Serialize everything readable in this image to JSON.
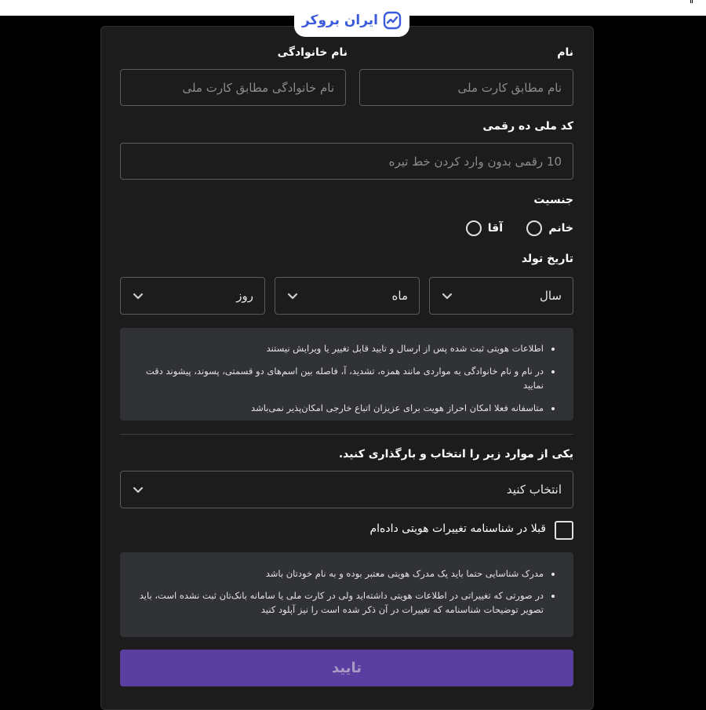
{
  "brand": {
    "name": "ایران بروکر",
    "accent": "#3b5bdb"
  },
  "form": {
    "first_name": {
      "label": "نام",
      "placeholder": "نام مطابق کارت ملی"
    },
    "last_name": {
      "label": "نام خانوادگی",
      "placeholder": "نام خانوادگی مطابق کارت ملی"
    },
    "national_code": {
      "label": "کد ملی ده رقمی",
      "placeholder": "10 رقمی بدون وارد کردن خط تیره"
    },
    "gender": {
      "label": "جنسیت",
      "options": [
        "خانم",
        "آقا"
      ]
    },
    "birth_date": {
      "label": "تاریخ تولد",
      "year": "سال",
      "month": "ماه",
      "day": "روز"
    },
    "notes1": [
      "اطلاعات هویتی ثبت شده پس از ارسال و تایید قابل تغییر یا ویرایش نیستند",
      "در نام و نام خانوادگی به مواردی مانند همزه، تشدید، آ، فاصله بین اسم‌های دو قسمتی، پسوند، پیشوند دقت نمایید",
      "متاسفانه فعلا امکان احراز هویت برای عزیزان اتباع خارجی امکان‌پذیر نمی‌باشد"
    ],
    "upload": {
      "label": "یکی از موارد زیر را انتخاب و بارگذاری کنید.",
      "select_value": "انتخاب کنید"
    },
    "checkbox_label": "قبلا در شناسنامه تغییرات هویتی داده‌ام",
    "notes2": [
      "مدرک شناسایی حتما باید یک مدرک هویتی معتبر بوده و به نام خودتان باشد",
      "در صورتی که تغییراتی در اطلاعات هویتی داشته‌اید ولی در کارت ملی یا سامانه بانک‌تان ثبت نشده است، باید تصویر توضیحات شناسنامه که تغییرات در آن ذکر شده است را نیز آپلود کنید"
    ],
    "submit_label": "تایید",
    "submit_color": "#5b3fa0"
  }
}
